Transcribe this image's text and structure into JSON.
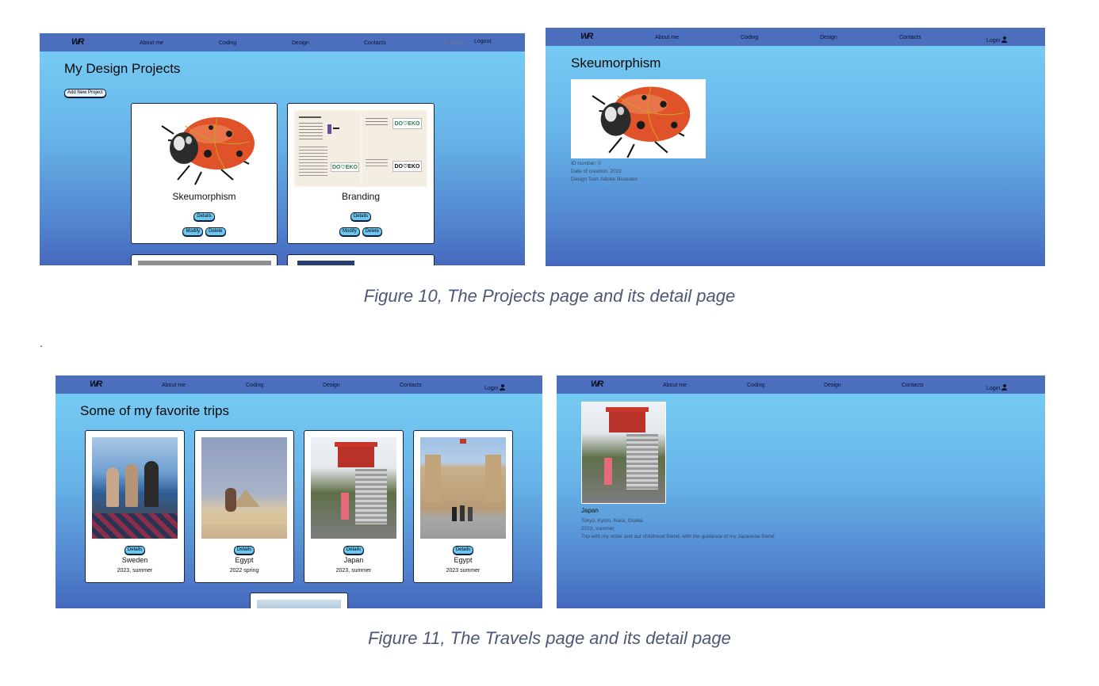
{
  "figure10": {
    "caption": "Figure 10, The Projects page and its detail page",
    "projects_page": {
      "logo": "WR",
      "nav": [
        "About me",
        "Coding",
        "Design",
        "Contacts"
      ],
      "greeting": "Hi, Réka!",
      "logout": "Logout",
      "heading": "My Design Projects",
      "add_button": "Add New Project",
      "cards": [
        {
          "title": "Skeumorphism",
          "details": "Details",
          "modify": "Modify",
          "delete": "Delete"
        },
        {
          "title": "Branding",
          "details": "Details",
          "modify": "Modify",
          "delete": "Delete"
        }
      ],
      "branding_thumb": {
        "logo_a": "DO♡EKO",
        "logo_b": "DO♡EKO",
        "logo_c": "DO♡EKO"
      }
    },
    "detail_page": {
      "logo": "WR",
      "nav": [
        "About me",
        "Coding",
        "Design",
        "Contacts"
      ],
      "login": "Login",
      "heading": "Skeumorphism",
      "meta": [
        "ID number: 0",
        "Date of creation: 2022",
        "Design Tool: Adobe Illustrator"
      ]
    }
  },
  "separator": ".",
  "figure11": {
    "caption": "Figure 11, The Travels page and its detail page",
    "travels_page": {
      "logo": "WR",
      "nav": [
        "About me",
        "Coding",
        "Design",
        "Contacts"
      ],
      "login": "Login",
      "heading": "Some of my favorite trips",
      "trips": [
        {
          "details": "Details",
          "country": "Sweden",
          "date": "2023, summer"
        },
        {
          "details": "Details",
          "country": "Egypt",
          "date": "2022 spring"
        },
        {
          "details": "Details",
          "country": "Japan",
          "date": "2023, summer"
        },
        {
          "details": "Details",
          "country": "Egypt",
          "date": "2023 summer"
        }
      ]
    },
    "detail_page": {
      "logo": "WR",
      "nav": [
        "About me",
        "Coding",
        "Design",
        "Contacts"
      ],
      "login": "Login",
      "title": "Japan",
      "meta": [
        "Tokyo, Kyoto, Nara, Osaka",
        "2023, summer",
        "Trip with my sister and our childhood friend, with the guidance of my Japanese friend"
      ]
    }
  }
}
